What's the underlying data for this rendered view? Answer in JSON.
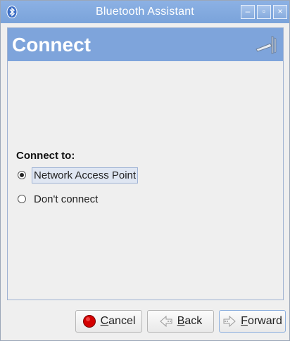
{
  "window": {
    "title": "Bluetooth Assistant"
  },
  "page": {
    "heading": "Connect"
  },
  "form": {
    "label": "Connect to:",
    "options": [
      {
        "label": "Network Access Point",
        "selected": true
      },
      {
        "label": "Don't connect",
        "selected": false
      }
    ]
  },
  "buttons": {
    "cancel": {
      "mnemonic": "C",
      "rest": "ancel"
    },
    "back": {
      "mnemonic": "B",
      "rest": "ack"
    },
    "forward": {
      "mnemonic": "F",
      "rest": "orward"
    }
  },
  "colors": {
    "titlebar": "#7aa3da",
    "banner": "#7ea4db",
    "cancel_icon": "#d40000"
  }
}
